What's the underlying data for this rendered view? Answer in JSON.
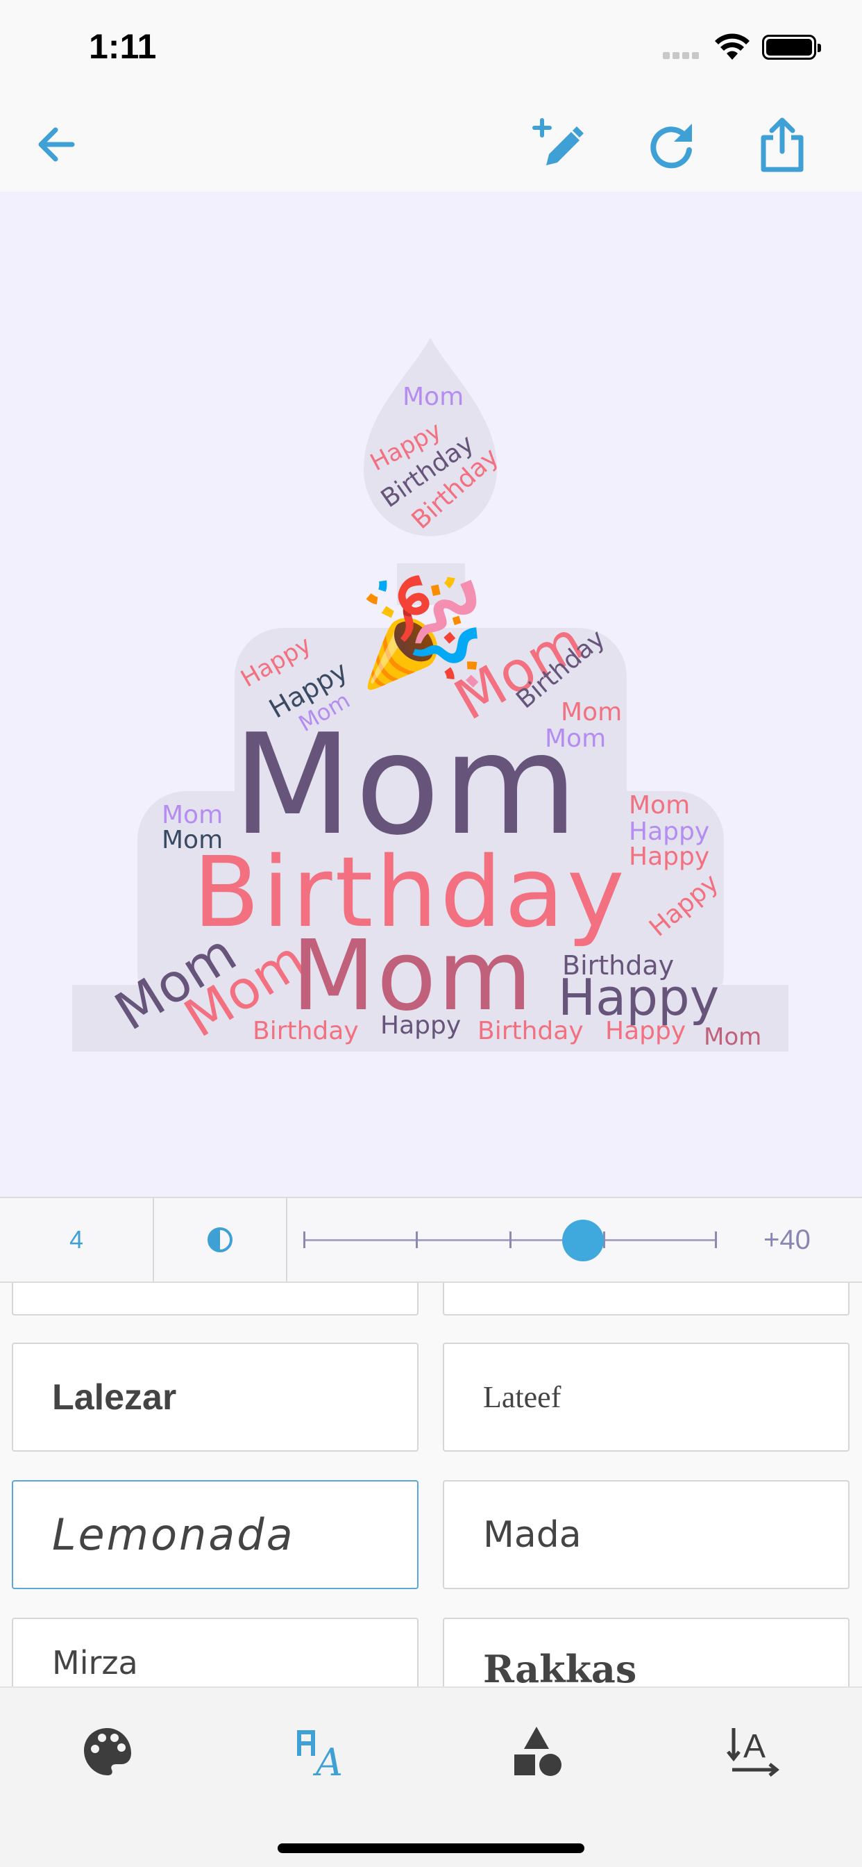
{
  "status_bar": {
    "time": "1:11"
  },
  "toolbar": {
    "back": "arrow-left-icon",
    "edit": "edit-plus-icon",
    "refresh": "refresh-icon",
    "share": "share-icon"
  },
  "word_cloud": {
    "words": [
      "Mom",
      "Happy",
      "Birthday",
      "Birthday",
      "Happy",
      "Happy",
      "Mom",
      "Mom",
      "Birthday",
      "Mom",
      "Mom",
      "Mom",
      "Birthday",
      "Mom",
      "Mom",
      "Mom",
      "Happy",
      "Happy",
      "Happy",
      "Mom",
      "Mom",
      "Mom",
      "Birthday",
      "Happy",
      "Birthday",
      "Happy",
      "Birthday",
      "Happy",
      "Mom"
    ],
    "emoji": "🎉",
    "colors": {
      "coral": "#f2707f",
      "plum": "#66547a",
      "lavender": "#b58cf2",
      "navy": "#3a4a63",
      "rose": "#c0607a"
    }
  },
  "slider": {
    "count": "4",
    "value": "+40",
    "opacity_icon": "opacity-icon"
  },
  "fonts": [
    "Lalezar",
    "Lateef",
    "Lemonada",
    "Mada",
    "Mirza",
    "Rakkas"
  ],
  "selected_font": "Lemonada",
  "tabs": [
    "palette-icon",
    "font-icon",
    "shapes-icon",
    "text-direction-icon"
  ]
}
